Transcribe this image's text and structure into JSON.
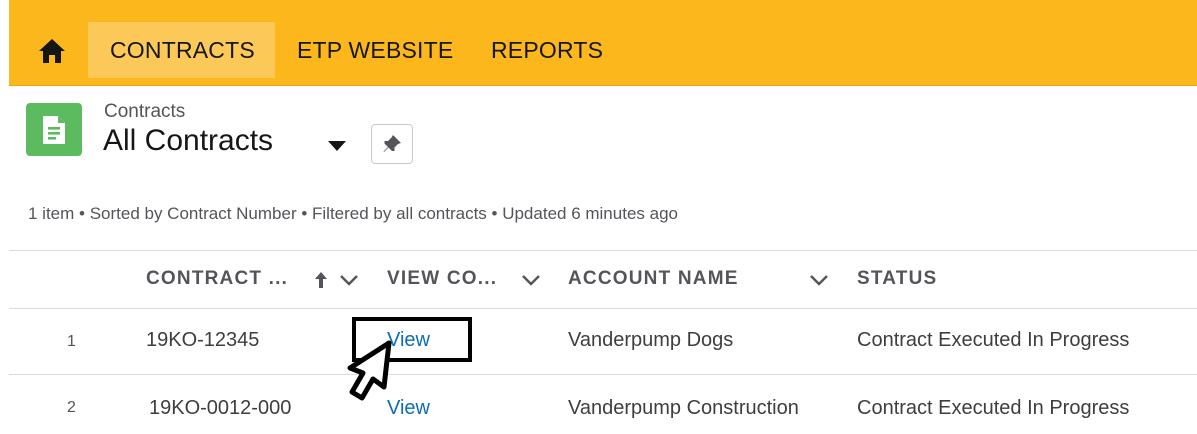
{
  "nav": {
    "tabs": [
      {
        "label": "CONTRACTS",
        "active": true
      },
      {
        "label": "ETP WEBSITE",
        "active": false
      },
      {
        "label": "REPORTS",
        "active": false
      }
    ]
  },
  "header": {
    "breadcrumb": "Contracts",
    "title": "All Contracts"
  },
  "list_meta": "1 item • Sorted by Contract Number • Filtered by all contracts • Updated 6 minutes ago",
  "table": {
    "columns": [
      "CONTRACT ...",
      "VIEW CO...",
      "ACCOUNT NAME",
      "STATUS"
    ],
    "rows": [
      {
        "num": "1",
        "contract": "19KO-12345",
        "view": "View",
        "account": "Vanderpump Dogs",
        "status": "Contract Executed In Progress"
      },
      {
        "num": "2",
        "contract": "19KO-0012-000",
        "view": "View",
        "account": "Vanderpump Construction",
        "status": "Contract Executed In Progress"
      }
    ]
  },
  "colors": {
    "nav_bg": "#fcb71d",
    "nav_active": "#fcc858",
    "object_icon": "#5dbb5f",
    "link": "#0b6fb4"
  },
  "icons": {
    "home": "home-icon",
    "object": "contract-document-icon",
    "caret": "caret-down-icon",
    "pin": "pin-icon",
    "sort": "arrow-up-icon",
    "column_menu": "chevron-down-icon",
    "pointer": "cursor-pointer-icon"
  }
}
